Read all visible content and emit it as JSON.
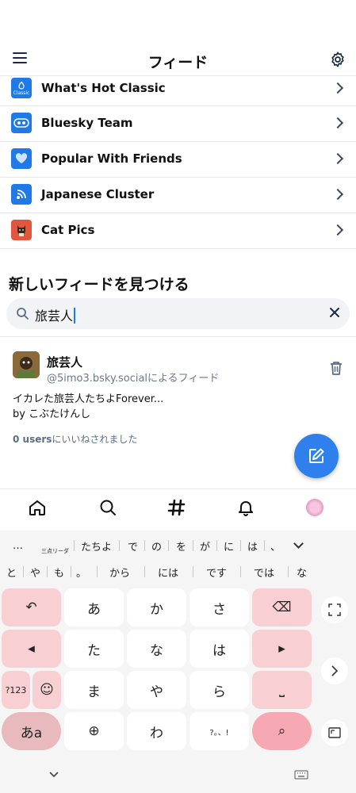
{
  "header": {
    "title": "フィード"
  },
  "feeds": [
    {
      "label": "What's Hot Classic",
      "icon": "flame-icon",
      "icon_text": "Classic",
      "color": "#1f7ae8"
    },
    {
      "label": "Bluesky Team",
      "icon": "team-icon",
      "icon_text": "",
      "color": "#1f7ae8"
    },
    {
      "label": "Popular With Friends",
      "icon": "heart-icon",
      "icon_text": "",
      "color": "#1f7ae8"
    },
    {
      "label": "Japanese Cluster",
      "icon": "signal-icon",
      "icon_text": "",
      "color": "#1f7ae8"
    },
    {
      "label": "Cat Pics",
      "icon": "cat-icon",
      "icon_text": "",
      "color": "#e2563d"
    }
  ],
  "discover": {
    "title": "新しいフィードを見つける",
    "search_value": "旅芸人"
  },
  "result": {
    "name": "旅芸人",
    "subtitle": "@5imo3.bsky.socialによるフィード",
    "desc_line1": "イカレた旅芸人たちよForever...",
    "desc_line2": "by こぶたけんし",
    "likes_count": "0 users",
    "likes_suffix": "にいいねされました"
  },
  "keyboard": {
    "suggestions_row1": [
      "…",
      "三点リーダ",
      "たちよ",
      "で",
      "の",
      "を",
      "が",
      "に",
      "は",
      "、"
    ],
    "suggestions_row2": [
      "と",
      "や",
      "も",
      "。",
      "から",
      "には",
      "です",
      "では",
      "な"
    ],
    "keys": {
      "undo": "↶",
      "a": "あ",
      "ka": "か",
      "sa": "さ",
      "backspace": "⌫",
      "left": "◂",
      "ta": "た",
      "na": "な",
      "ha": "は",
      "right": "▸",
      "num": "?123",
      "emoji": "☺",
      "ma": "ま",
      "ya": "や",
      "ra": "ら",
      "space": "⎵",
      "kana": "あa",
      "globe": "⊕",
      "wa": "わ",
      "punct": "?。、!",
      "search": "⌕"
    }
  },
  "colors": {
    "accent": "#2f80ed",
    "pink_key": "#f8d0d3"
  }
}
